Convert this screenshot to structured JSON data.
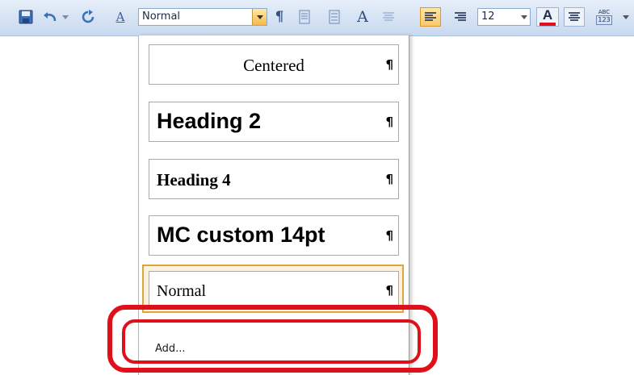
{
  "toolbar": {
    "icons": [
      "save-icon",
      "undo-icon",
      "undo-dropdown-icon",
      "redo-icon",
      "styles-pane-icon",
      "show-formatting-icon",
      "justify-icon",
      "line-spacing-icon",
      "text-style-icon",
      "distributed-icon",
      "align-left-icon",
      "align-right-icon",
      "font-color-icon",
      "align-center-icon",
      "spelling-icon"
    ],
    "styles_button_label": "A",
    "style_value": "Normal",
    "font_size_value": "12",
    "font_color_label": "A",
    "spell_check_top": "ABC",
    "spell_check_bottom": "123",
    "colors": {
      "toolbar_bg": "#c8d9ef",
      "highlight": "#f9c96b",
      "font_color_bar": "#e0101a"
    }
  },
  "style_dropdown": {
    "items": [
      {
        "label": "Centered",
        "mark": "¶"
      },
      {
        "label": "Heading 2",
        "mark": "¶"
      },
      {
        "label": "Heading 4",
        "mark": "¶"
      },
      {
        "label": "MC custom 14pt",
        "mark": "¶"
      },
      {
        "label": "Normal",
        "mark": "¶",
        "selected": true
      }
    ],
    "add_label": "Add..."
  },
  "annotation": {
    "color": "#e0101a"
  }
}
